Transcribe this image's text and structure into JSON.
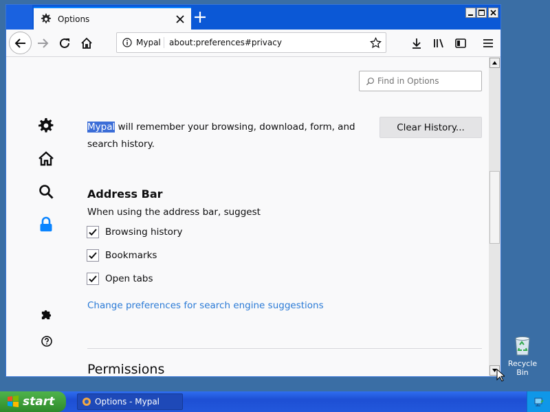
{
  "tab": {
    "title": "Options",
    "icon": "gear-icon"
  },
  "urlbar": {
    "site_label": "Mypal",
    "url": "about:preferences#privacy"
  },
  "search": {
    "placeholder": "Find in Options"
  },
  "history": {
    "highlighted_word": "Mypal",
    "text_rest": " will remember your browsing, download, form, and search history.",
    "clear_button": "Clear History..."
  },
  "address_bar": {
    "heading": "Address Bar",
    "subtext": "When using the address bar, suggest",
    "options": [
      {
        "label": "Browsing history",
        "checked": true
      },
      {
        "label": "Bookmarks",
        "checked": true
      },
      {
        "label": "Open tabs",
        "checked": true
      }
    ],
    "link": "Change preferences for search engine suggestions"
  },
  "permissions": {
    "heading": "Permissions"
  },
  "sidebar": {
    "categories": [
      "general-gear-icon",
      "home-icon",
      "search-icon",
      "privacy-lock-icon"
    ],
    "bottom": [
      "extensions-puzzle-icon",
      "help-icon"
    ],
    "active_color": "#0a84ff"
  },
  "desktop": {
    "recycle_bin": "Recycle Bin"
  },
  "taskbar": {
    "start_label": "start",
    "task_button": "Options - Mypal"
  },
  "colors": {
    "link": "#2a7ad6",
    "selection": "#3b6dd7",
    "titlebar": "#0b58d6"
  }
}
